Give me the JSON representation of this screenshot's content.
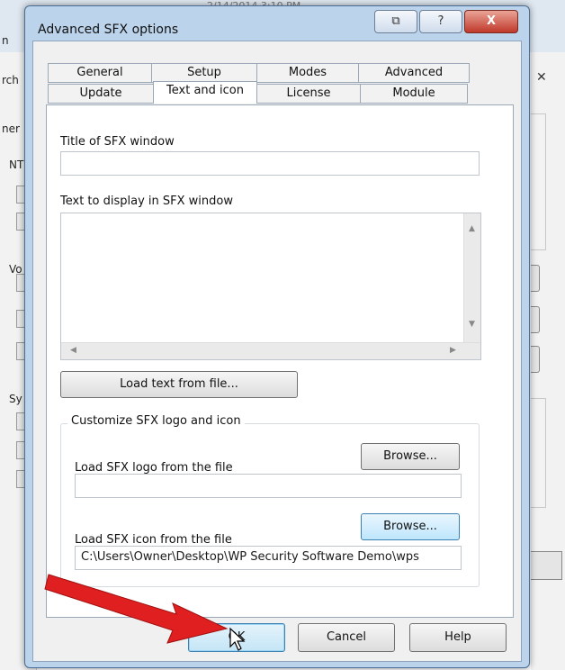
{
  "background": {
    "top_fragment": "2/14/2014 3:10 PM",
    "left_fragments": [
      "n",
      "rch",
      "ner",
      "NT",
      "Vo",
      "Sy"
    ],
    "right_close": "✕"
  },
  "dialog": {
    "title": "Advanced SFX options",
    "title_buttons": {
      "restore": "⧉",
      "help": "?",
      "close": "X"
    }
  },
  "tabs": {
    "row_back": [
      "General",
      "Setup",
      "Modes",
      "Advanced"
    ],
    "row_front": [
      "Update",
      "Text and icon",
      "License",
      "Module"
    ],
    "active": "Text and icon"
  },
  "panel": {
    "title_label": "Title of SFX window",
    "title_value": "",
    "text_label": "Text to display in SFX window",
    "text_value": "",
    "load_text_button": "Load text from file...",
    "group_title": "Customize SFX logo and icon",
    "logo_label": "Load SFX logo from the file",
    "logo_browse": "Browse...",
    "logo_value": "",
    "icon_label": "Load SFX icon from the file",
    "icon_browse": "Browse...",
    "icon_value": "C:\\Users\\Owner\\Desktop\\WP Security Software Demo\\wps"
  },
  "buttons": {
    "ok": "OK",
    "cancel": "Cancel",
    "help": "Help"
  },
  "colors": {
    "arrow": "#e02020",
    "title_bar": "#bcd3ec",
    "accent": "#3c7fb1"
  }
}
